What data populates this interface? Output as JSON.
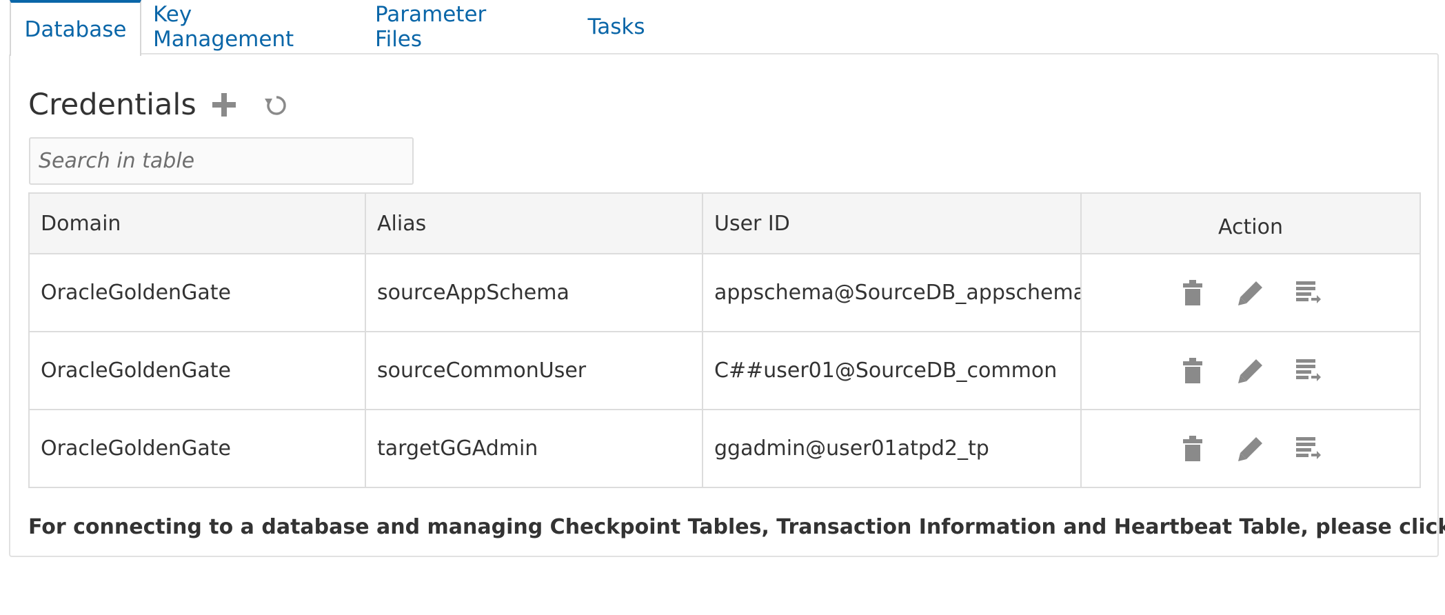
{
  "tabs": [
    {
      "label": "Database",
      "active": true
    },
    {
      "label": "Key Management",
      "active": false
    },
    {
      "label": "Parameter Files",
      "active": false
    },
    {
      "label": "Tasks",
      "active": false
    }
  ],
  "section": {
    "title": "Credentials",
    "add_icon": "plus-icon",
    "refresh_icon": "refresh-icon"
  },
  "search": {
    "placeholder": "Search in table",
    "value": ""
  },
  "table": {
    "columns": [
      "Domain",
      "Alias",
      "User ID",
      "Action"
    ],
    "rows": [
      {
        "domain": "OracleGoldenGate",
        "alias": "sourceAppSchema",
        "user_id": "appschema@SourceDB_appschema"
      },
      {
        "domain": "OracleGoldenGate",
        "alias": "sourceCommonUser",
        "user_id": "C##user01@SourceDB_common"
      },
      {
        "domain": "OracleGoldenGate",
        "alias": "targetGGAdmin",
        "user_id": "ggadmin@user01atpd2_tp"
      }
    ],
    "action_icons": [
      "trash-icon",
      "pencil-icon",
      "connect-db-icon"
    ]
  },
  "footer": {
    "text": "For connecting to a database and managing Checkpoint Tables, Transaction Information and Heartbeat Table, please click:"
  },
  "colors": {
    "accent": "#0a66a8",
    "icon_gray": "#8a8a8a",
    "border": "#dcdcdc",
    "header_bg": "#f5f5f5"
  }
}
